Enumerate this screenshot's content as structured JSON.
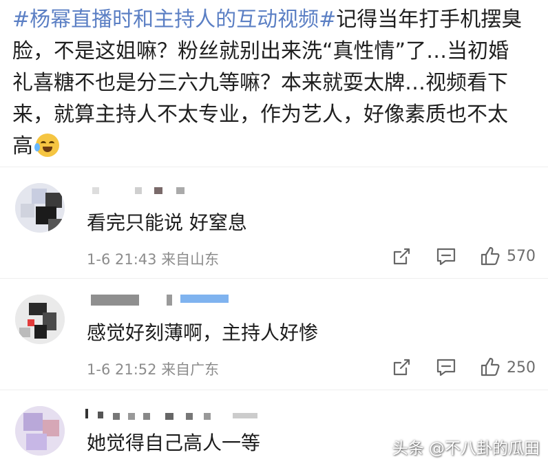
{
  "post": {
    "hashtag": "#杨幂直播时和主持人的互动视频#",
    "lines": [
      "记得当年打手机摆臭",
      "脸，不是这姐嘛？粉丝就别出来洗“真性情”了…当初婚",
      "礼喜糖不也是分三六九等嘛？本来就耍太牌…视频看下",
      "来，就算主持人不太专业，作为艺人，好像素质也不太",
      "高"
    ],
    "emoji_icon": "laugh-cry-emoji-icon"
  },
  "comments": [
    {
      "text": "看完只能说 好窒息",
      "date": "1-6 21:43",
      "location": "来自山东",
      "likes": "570"
    },
    {
      "text": "感觉好刻薄啊，主持人好惨",
      "date": "1-6 21:52",
      "location": "来自广东",
      "likes": "250"
    },
    {
      "text": "她觉得自己高人一等"
    }
  ],
  "icons": {
    "share": "share-icon",
    "comment": "comment-icon",
    "like": "thumbs-up-icon"
  },
  "watermark": "头条 @不八卦的瓜田",
  "colors": {
    "hashtag": "#5b7fc4",
    "meta": "#8c8c8c",
    "text": "#1c1c1c"
  }
}
